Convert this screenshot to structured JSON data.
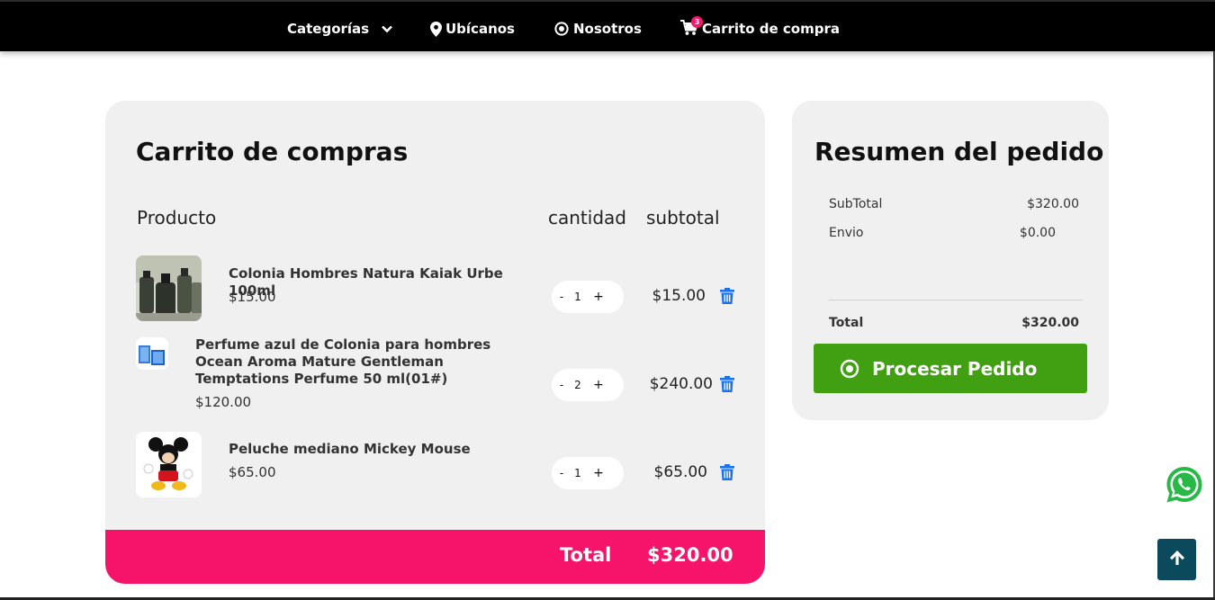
{
  "nav": {
    "categories_label": "Categorías",
    "location_label": "Ubícanos",
    "about_label": "Nosotros",
    "cart_label": "Carrito de compra",
    "cart_count": "3"
  },
  "cart": {
    "title": "Carrito de compras",
    "col_product": "Producto",
    "col_quantity": "cantidad",
    "col_subtotal": "subtotal",
    "items": [
      {
        "name": "Colonia Hombres Natura Kaiak Urbe 100ml",
        "price": "$15.00",
        "quantity": "1",
        "subtotal": "$15.00",
        "minus": "-",
        "plus": "+"
      },
      {
        "name": "Perfume azul de Colonia para hombres Ocean Aroma Mature Gentleman Temptations Perfume 50 ml(01#)",
        "price": "$120.00",
        "quantity": "2",
        "subtotal": "$240.00",
        "minus": "-",
        "plus": "+"
      },
      {
        "name": "Peluche mediano Mickey Mouse",
        "price": "$65.00",
        "quantity": "1",
        "subtotal": "$65.00",
        "minus": "-",
        "plus": "+"
      }
    ],
    "total_label": "Total",
    "total_value": "$320.00"
  },
  "summary": {
    "title": "Resumen del pedido",
    "subtotal_label": "SubTotal",
    "subtotal_value": "$320.00",
    "shipping_label": "Envio",
    "shipping_value": "$0.00",
    "total_label": "Total",
    "total_value": "$320.00",
    "process_label": "Procesar Pedido"
  },
  "colors": {
    "accent_pink": "#f5146a",
    "process_green": "#41a012",
    "trash_blue": "#1a73e8",
    "back_to_top": "#0b4a5c"
  }
}
